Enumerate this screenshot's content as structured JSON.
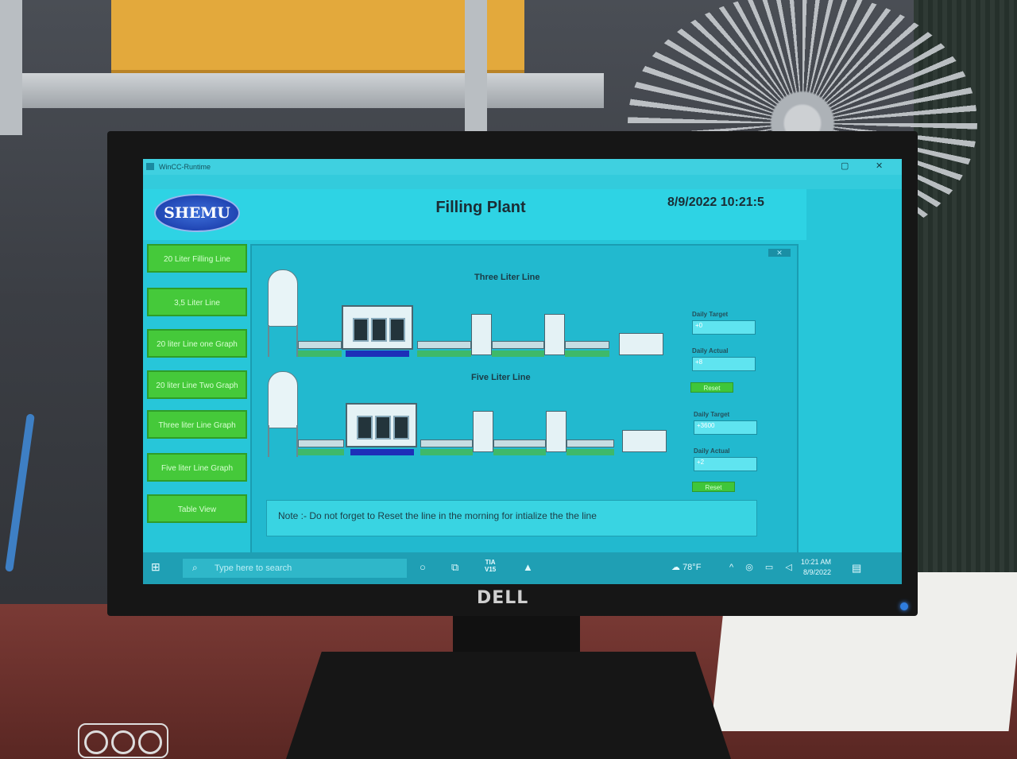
{
  "window": {
    "title": "WinCC-Runtime",
    "controls": [
      "▢",
      "✕"
    ]
  },
  "header": {
    "brand": "SHEMU",
    "title": "Filling Plant",
    "datetime": "8/9/2022 10:21:5"
  },
  "nav": {
    "items": [
      {
        "label": "20 Liter Filling Line"
      },
      {
        "label": "3,5 Liter Line"
      },
      {
        "label": "20 liter Line one Graph"
      },
      {
        "label": "20 liter Line Two Graph"
      },
      {
        "label": "Three liter Line  Graph"
      },
      {
        "label": "Five liter Line  Graph"
      },
      {
        "label": "Table View"
      }
    ]
  },
  "lines": {
    "three": {
      "title": "Three Liter Line",
      "target_label": "Daily Target",
      "target_value": "+0",
      "actual_label": "Daily Actual",
      "actual_value": "+8",
      "reset_label": "Reset"
    },
    "five": {
      "title": "Five Liter Line",
      "target_label": "Daily Target",
      "target_value": "+3600",
      "actual_label": "Daily Actual",
      "actual_value": "+2",
      "reset_label": "Reset"
    }
  },
  "note": "Note :- Do not forget to Reset the line in the morning for intialize the the line",
  "taskbar": {
    "search_placeholder": "Type here to search",
    "tia_label_1": "TIA",
    "tia_label_2": "V15",
    "weather": "78°F",
    "time": "10:21 AM",
    "date": "8/9/2022"
  },
  "monitor": {
    "brand": "DELL"
  },
  "colors": {
    "screen_bg": "#27c6d9",
    "nav_button": "#45c93a",
    "brand_blue": "#1c3fae"
  }
}
